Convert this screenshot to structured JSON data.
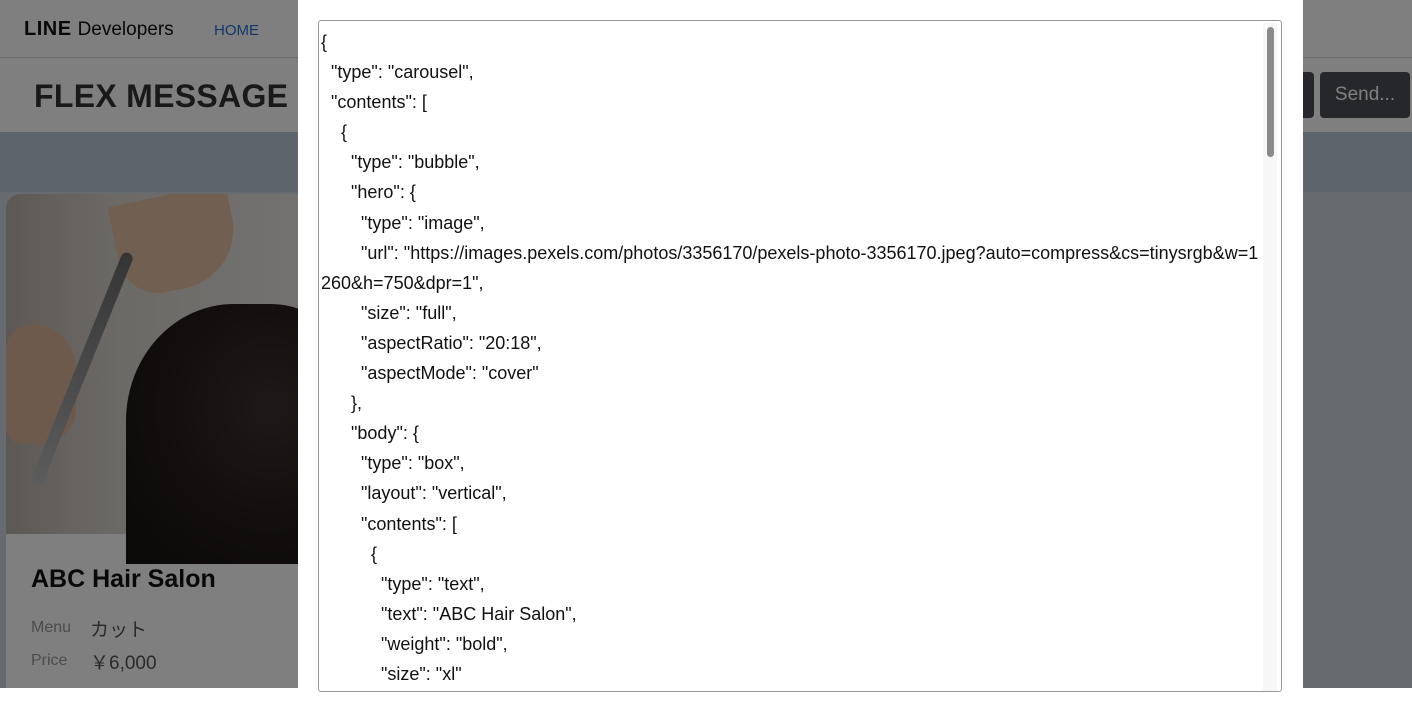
{
  "nav": {
    "logo_line": "LINE",
    "logo_developers": "Developers",
    "home_link": "HOME"
  },
  "header": {
    "title": "FLEX MESSAGE S",
    "send_button": "Send..."
  },
  "card": {
    "name": "ABC Hair Salon",
    "menu_label": "Menu",
    "menu_value": "カット",
    "price_label": "Price",
    "price_value": "￥6,000"
  },
  "editor": {
    "content": "{\n  \"type\": \"carousel\",\n  \"contents\": [\n    {\n      \"type\": \"bubble\",\n      \"hero\": {\n        \"type\": \"image\",\n        \"url\": \"https://images.pexels.com/photos/3356170/pexels-photo-3356170.jpeg?auto=compress&cs=tinysrgb&w=1260&h=750&dpr=1\",\n        \"size\": \"full\",\n        \"aspectRatio\": \"20:18\",\n        \"aspectMode\": \"cover\"\n      },\n      \"body\": {\n        \"type\": \"box\",\n        \"layout\": \"vertical\",\n        \"contents\": [\n          {\n            \"type\": \"text\",\n            \"text\": \"ABC Hair Salon\",\n            \"weight\": \"bold\",\n            \"size\": \"xl\""
  },
  "colors": {
    "link": "#1e6fd0",
    "button_dark": "#4a4f55",
    "overlay": "rgba(0,0,0,0.5)"
  }
}
